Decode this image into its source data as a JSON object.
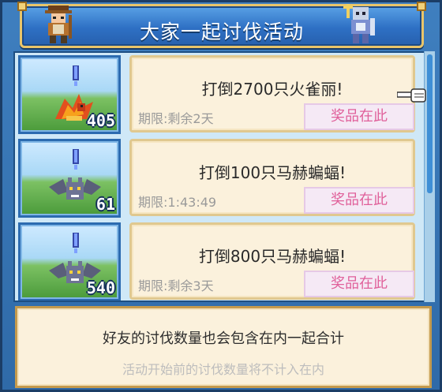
{
  "header": {
    "title": "大家一起讨伐活动"
  },
  "quests": [
    {
      "count": "405",
      "goal": "打倒2700只火雀丽!",
      "limit": "期限:剩余2天",
      "prize_label": "奖品在此",
      "monster": "fire-bird-icon"
    },
    {
      "count": "61",
      "goal": "打倒100只马赫蝙蝠!",
      "limit": "期限:1:43:49",
      "prize_label": "奖品在此",
      "monster": "bat-icon"
    },
    {
      "count": "540",
      "goal": "打倒800只马赫蝙蝠!",
      "limit": "期限:剩余3天",
      "prize_label": "奖品在此",
      "monster": "bat-icon"
    }
  ],
  "footer": {
    "note_primary": "好友的讨伐数量也会包含在内一起合计",
    "note_secondary": "活动开始前的讨伐数量将不计入在内"
  },
  "colors": {
    "accent_blue": "#2e70c4",
    "card_bg": "#fbf1dc",
    "prize_text": "#e0609a",
    "border_gold": "#e9c56a"
  }
}
